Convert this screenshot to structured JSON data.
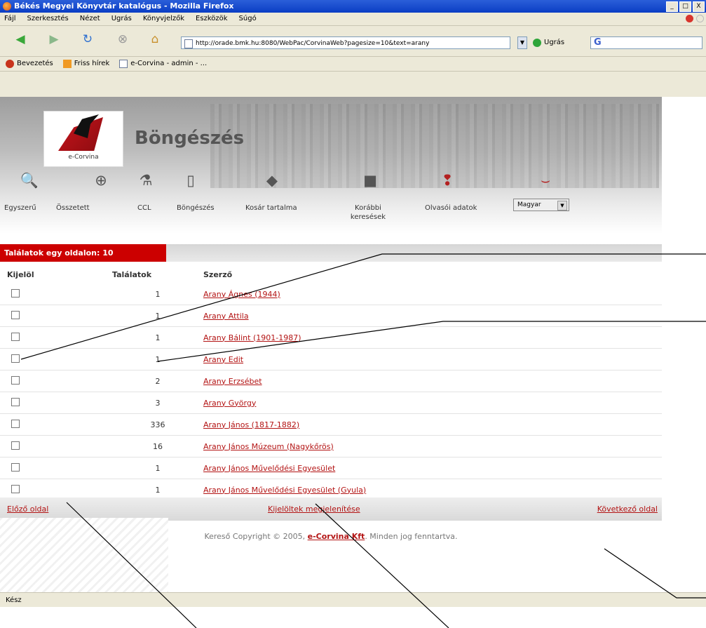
{
  "window": {
    "title": "Békés Megyei Könyvtár katalógus - Mozilla Firefox",
    "buttons": [
      "_",
      "□",
      "X"
    ]
  },
  "menubar": [
    "Fájl",
    "Szerkesztés",
    "Nézet",
    "Ugrás",
    "Könyvjelzők",
    "Eszközök",
    "Súgó"
  ],
  "navbar": {
    "url": "http://orade.bmk.hu:8080/WebPac/CorvinaWeb?pagesize=10&text=arany",
    "go_label": "Ugrás",
    "search_placeholder": "G"
  },
  "bookmarks": [
    "Bevezetés",
    "Friss hírek",
    "e-Corvina - admin - ..."
  ],
  "header": {
    "logo_text": "e-Corvina",
    "title": "Böngészés"
  },
  "nav_links": [
    "Egyszerű",
    "Összetett",
    "CCL",
    "Böngészés",
    "Kosár tartalma",
    "Korábbi keresések",
    "Olvasói adatok"
  ],
  "language": "Magyar",
  "results_per_page": "Találatok egy oldalon: 10",
  "table": {
    "headers": [
      "Kijelöl",
      "Találatok",
      "Szerző"
    ],
    "rows": [
      {
        "count": "1",
        "author": "Arany Ágnes (1944)"
      },
      {
        "count": "1",
        "author": "Arany Attila"
      },
      {
        "count": "1",
        "author": "Arany Bálint (1901-1987)"
      },
      {
        "count": "1",
        "author": "Arany Edit"
      },
      {
        "count": "2",
        "author": "Arany Erzsébet"
      },
      {
        "count": "3",
        "author": "Arany György"
      },
      {
        "count": "336",
        "author": "Arany János (1817-1882)"
      },
      {
        "count": "16",
        "author": "Arany János Múzeum (Nagykőrös)"
      },
      {
        "count": "1",
        "author": "Arany János Művelődési Egyesület"
      },
      {
        "count": "1",
        "author": "Arany János Művelődési Egyesület (Gyula)"
      }
    ]
  },
  "pager": {
    "prev": "Előző oldal",
    "show_selected": "Kijelöltek megjelenítése",
    "next": "Következő oldal"
  },
  "footer": {
    "prefix": "Kereső Copyright © 2005, ",
    "company": "e-Corvina Kft",
    "suffix": ". Minden jog fenntartva."
  },
  "status": "Kész"
}
